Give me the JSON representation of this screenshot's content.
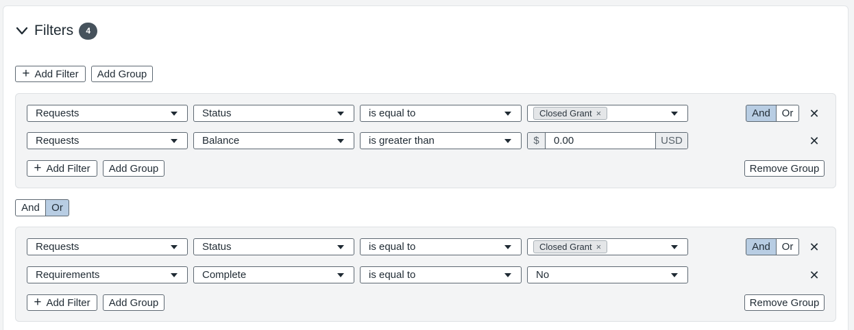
{
  "filters": {
    "title": "Filters",
    "count": "4",
    "add_filter_label": "Add Filter",
    "add_group_label": "Add Group",
    "top_connector": {
      "and_label": "And",
      "or_label": "Or",
      "active": "Or"
    },
    "groups": [
      {
        "rows": [
          {
            "object": "Requests",
            "field": "Status",
            "operator": "is equal to",
            "value_chip": "Closed Grant"
          },
          {
            "object": "Requests",
            "field": "Balance",
            "operator": "is greater than",
            "currency_prefix": "$",
            "value": "0.00",
            "currency_suffix": "USD"
          }
        ],
        "connector": {
          "and_label": "And",
          "or_label": "Or",
          "active": "And"
        },
        "add_filter_label": "Add Filter",
        "add_group_label": "Add Group",
        "remove_group_label": "Remove Group"
      },
      {
        "rows": [
          {
            "object": "Requests",
            "field": "Status",
            "operator": "is equal to",
            "value_chip": "Closed Grant"
          },
          {
            "object": "Requirements",
            "field": "Complete",
            "operator": "is equal to",
            "value": "No"
          }
        ],
        "connector": {
          "and_label": "And",
          "or_label": "Or",
          "active": "And"
        },
        "add_filter_label": "Add Filter",
        "add_group_label": "Add Group",
        "remove_group_label": "Remove Group"
      }
    ]
  },
  "icons": {
    "chip_remove": "×",
    "row_remove": "✕",
    "plus": "+"
  },
  "colors": {
    "active_toggle": "#b8cde3",
    "badge": "#46525c",
    "group_bg": "#f3f4f5"
  }
}
